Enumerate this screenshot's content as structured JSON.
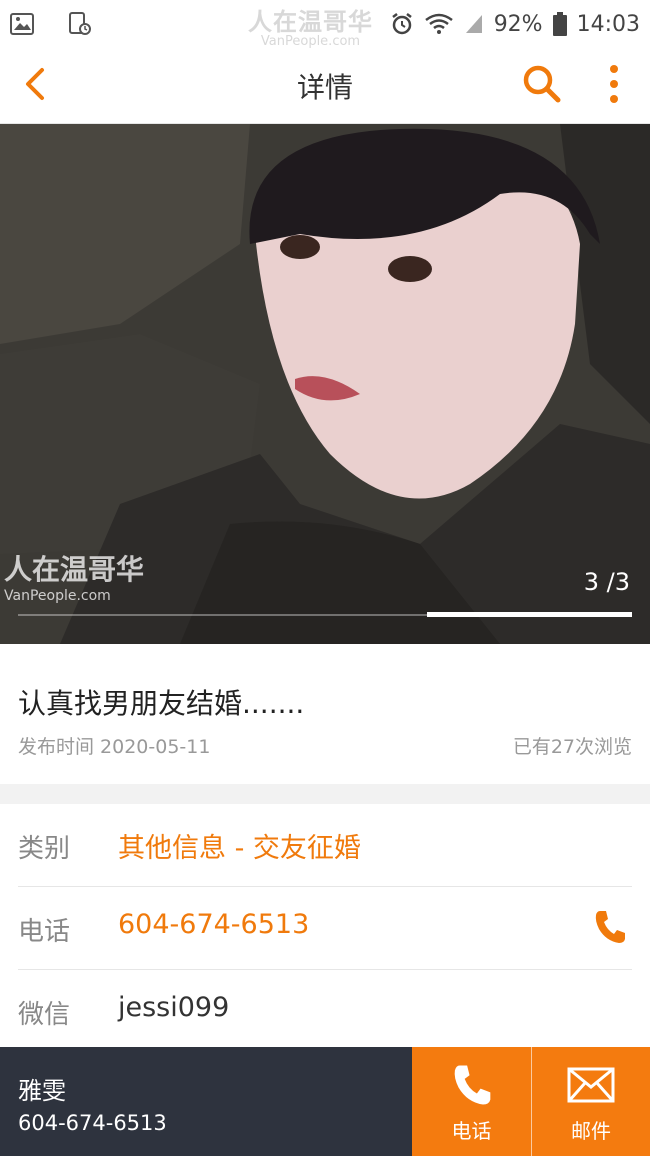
{
  "status_bar": {
    "watermark_main": "人在温哥华",
    "watermark_site": "VanPeople.com",
    "battery": "92%",
    "time": "14:03"
  },
  "nav": {
    "title": "详情",
    "accent_color": "#f07a0c"
  },
  "gallery": {
    "counter": "3 /3",
    "watermark_main": "人在温哥华",
    "watermark_site": "VanPeople.com",
    "current_index": 3,
    "total": 3
  },
  "post": {
    "title": "认真找男朋友结婚.......",
    "date": "发布时间 2020-05-11",
    "views": "已有27次浏览"
  },
  "details": {
    "category_label": "类别",
    "category_value": "其他信息 - 交友征婚",
    "phone_label": "电话",
    "phone_value": "604-674-6513",
    "wechat_label": "微信",
    "wechat_value": "jessi099"
  },
  "footer": {
    "contact_name": "雅雯",
    "contact_phone": "604-674-6513",
    "call_label": "电话",
    "mail_label": "邮件",
    "colors": {
      "dark": "#2e333e",
      "accent": "#f47b0f"
    }
  },
  "icons": [
    "back-arrow-icon",
    "search-icon",
    "more-icon",
    "phone-icon",
    "mail-icon",
    "image-icon",
    "screen-record-icon",
    "alarm-icon",
    "wifi-icon",
    "signal-icon",
    "battery-icon"
  ]
}
